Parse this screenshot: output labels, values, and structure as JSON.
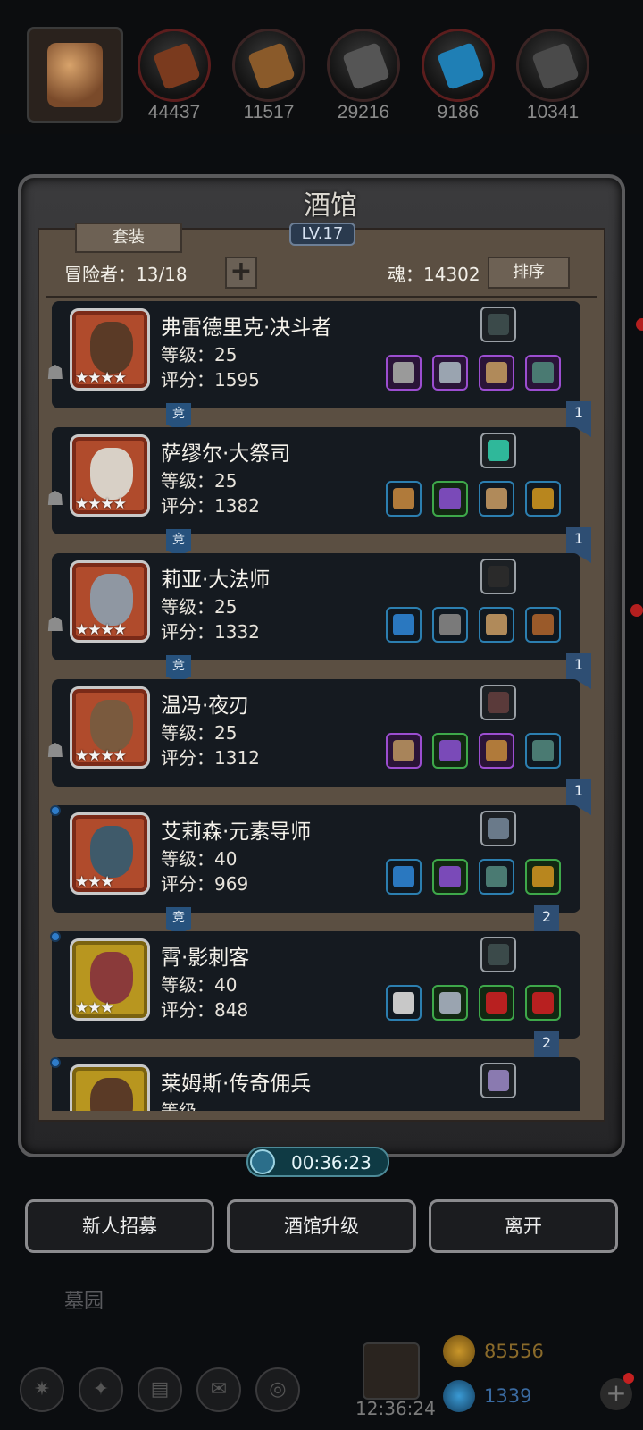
{
  "resources": [
    {
      "icon": "leather-icon",
      "value": "44437",
      "color": "#7a3a1e"
    },
    {
      "icon": "wood-icon",
      "value": "11517",
      "color": "#8a5a2a"
    },
    {
      "icon": "iron-icon",
      "value": "29216",
      "color": "#555555"
    },
    {
      "icon": "crystal-icon",
      "value": "9186",
      "color": "#1f7fb5"
    },
    {
      "icon": "steel-icon",
      "value": "10341",
      "color": "#4a4a4a"
    }
  ],
  "tavern": {
    "title": "酒馆",
    "level": "LV.17",
    "suit_button": "套装",
    "adventurers_label": "冒险者：13/18",
    "add_label": "+",
    "soul_label": "魂：14302",
    "sort_button": "排序"
  },
  "heroes": [
    {
      "name": "弗雷德里克·决斗者",
      "level": "等级：25",
      "score": "评分：1595",
      "stars": "★★★★",
      "frame": "red",
      "face": "#5a3a26",
      "badge": "竞",
      "rank": "1",
      "top_item_color": "#3b4a4a",
      "items": [
        [
          "purple",
          "#9a9a9a"
        ],
        [
          "purple",
          "#9aa4b0"
        ],
        [
          "purple",
          "#b08a5a"
        ],
        [
          "purple",
          "#4a7a72"
        ]
      ]
    },
    {
      "name": "萨缪尔·大祭司",
      "level": "等级：25",
      "score": "评分：1382",
      "stars": "★★★★",
      "frame": "red",
      "face": "#d8d0c6",
      "badge": "竞",
      "rank": "1",
      "top_item_color": "#2fb89a",
      "items": [
        [
          "blue",
          "#b07a3a"
        ],
        [
          "green",
          "#7a4ab8"
        ],
        [
          "blue",
          "#b08a5a"
        ],
        [
          "blue",
          "#b8861e"
        ]
      ]
    },
    {
      "name": "莉亚·大法师",
      "level": "等级：25",
      "score": "评分：1332",
      "stars": "★★★★",
      "frame": "red",
      "face": "#8f97a2",
      "badge": "竞",
      "rank": "1",
      "top_item_color": "#2a2a2a",
      "items": [
        [
          "blue",
          "#2a78c0"
        ],
        [
          "blue",
          "#7a7a7a"
        ],
        [
          "blue",
          "#b08a5a"
        ],
        [
          "blue",
          "#9a5a2a"
        ]
      ]
    },
    {
      "name": "温冯·夜刃",
      "level": "等级：25",
      "score": "评分：1312",
      "stars": "★★★★",
      "frame": "red",
      "face": "#7a5a3e",
      "badge": "",
      "rank": "1",
      "top_item_color": "#5a3a3a",
      "items": [
        [
          "purple",
          "#a8845a"
        ],
        [
          "green",
          "#7a4ab8"
        ],
        [
          "purple",
          "#b07a3a"
        ],
        [
          "blue",
          "#4a7a72"
        ]
      ]
    },
    {
      "name": "艾莉森·元素导师",
      "level": "等级：40",
      "score": "评分：969",
      "stars": "★★★",
      "frame": "red",
      "face": "#3f5a6a",
      "badge": "竞",
      "rank": "2",
      "top_item_color": "#6a7a8a",
      "items": [
        [
          "blue",
          "#2a78c0"
        ],
        [
          "green",
          "#7a4ab8"
        ],
        [
          "blue",
          "#4a7a72"
        ],
        [
          "green",
          "#b8861e"
        ]
      ]
    },
    {
      "name": "霄·影刺客",
      "level": "等级：40",
      "score": "评分：848",
      "stars": "★★★",
      "frame": "gold",
      "face": "#8a3a3a",
      "badge": "",
      "rank": "2",
      "top_item_color": "#3b4a4a",
      "items": [
        [
          "blue",
          "#c8c8c8"
        ],
        [
          "green",
          "#9aa4b0"
        ],
        [
          "green",
          "#b82020"
        ],
        [
          "green",
          "#b82020"
        ]
      ]
    },
    {
      "name": "莱姆斯·传奇佣兵",
      "level": "等级",
      "score": "",
      "stars": "",
      "frame": "gold",
      "face": "#5a3a26",
      "badge": "",
      "rank": "",
      "top_item_color": "#8a7ab0",
      "items": []
    }
  ],
  "timer": "00:36:23",
  "buttons": {
    "recruit": "新人招募",
    "upgrade": "酒馆升级",
    "leave": "离开"
  },
  "background_label": "墓园",
  "clock": "12:36:24",
  "gold": "85556",
  "gems": "1339"
}
